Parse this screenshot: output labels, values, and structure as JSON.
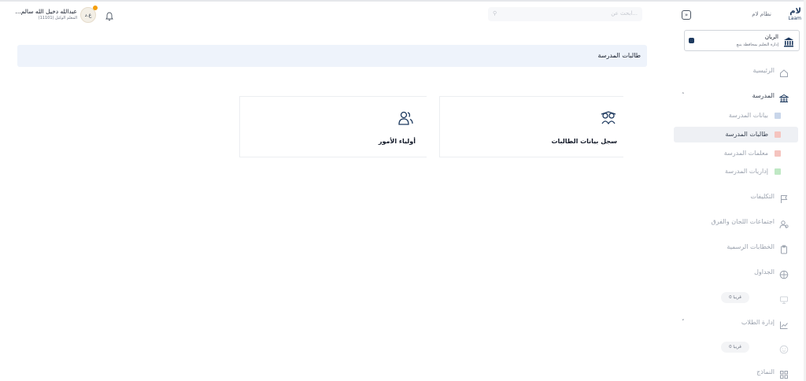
{
  "app": {
    "logo_text": "لام",
    "logo_latin": "Laam",
    "system_name": "نظام لام"
  },
  "org": {
    "name": "الريان",
    "subtitle": "إدارة التعليم بمحافظة ينبع"
  },
  "search": {
    "placeholder": "ابحث عن..."
  },
  "user": {
    "name": "عبدالله دخيل الله سالم...",
    "role": "المعلم الوكيل (11101)",
    "avatar_initials": "ع.د"
  },
  "sidebar": {
    "items": [
      {
        "label": "الرئيسية",
        "icon": "home-icon"
      },
      {
        "label": "المدرسة",
        "icon": "school-icon",
        "expanded": true
      },
      {
        "label": "التكليفات",
        "icon": "flag-icon"
      },
      {
        "label": "اجتماعات اللجان والفرق",
        "icon": "users-meeting-icon"
      },
      {
        "label": "الخطابات الرسمية",
        "icon": "clipboard-icon"
      },
      {
        "label": "الجداول",
        "icon": "grid-globe-icon"
      },
      {
        "label": "",
        "icon": "monitor-icon",
        "badge": "0 قريبا"
      },
      {
        "label": "إدارة الطلاب",
        "icon": "chart-icon"
      },
      {
        "label": "",
        "icon": "smile-icon",
        "badge": "0 قريبا"
      },
      {
        "label": "النماذج",
        "icon": "apps-icon"
      }
    ],
    "school_sub": [
      {
        "label": "بيانات المدرسة",
        "color": "#c9d6ea"
      },
      {
        "label": "طالبات المدرسة",
        "color": "#f5c4bf",
        "active": true
      },
      {
        "label": "معلمات المدرسة",
        "color": "#f5c4bf"
      },
      {
        "label": "إداريات المدرسة",
        "color": "#bfe8c4"
      }
    ]
  },
  "page": {
    "title": "طالبات المدرسة"
  },
  "cards": [
    {
      "label": "سجل بيانات الطالبات",
      "icon": "students-record-icon"
    },
    {
      "label": "أولياء الأمور",
      "icon": "parents-icon"
    }
  ],
  "colors": {
    "accent": "#1e3a5f",
    "title_bar": "#eef3fb",
    "active_row": "#eef0f4"
  }
}
